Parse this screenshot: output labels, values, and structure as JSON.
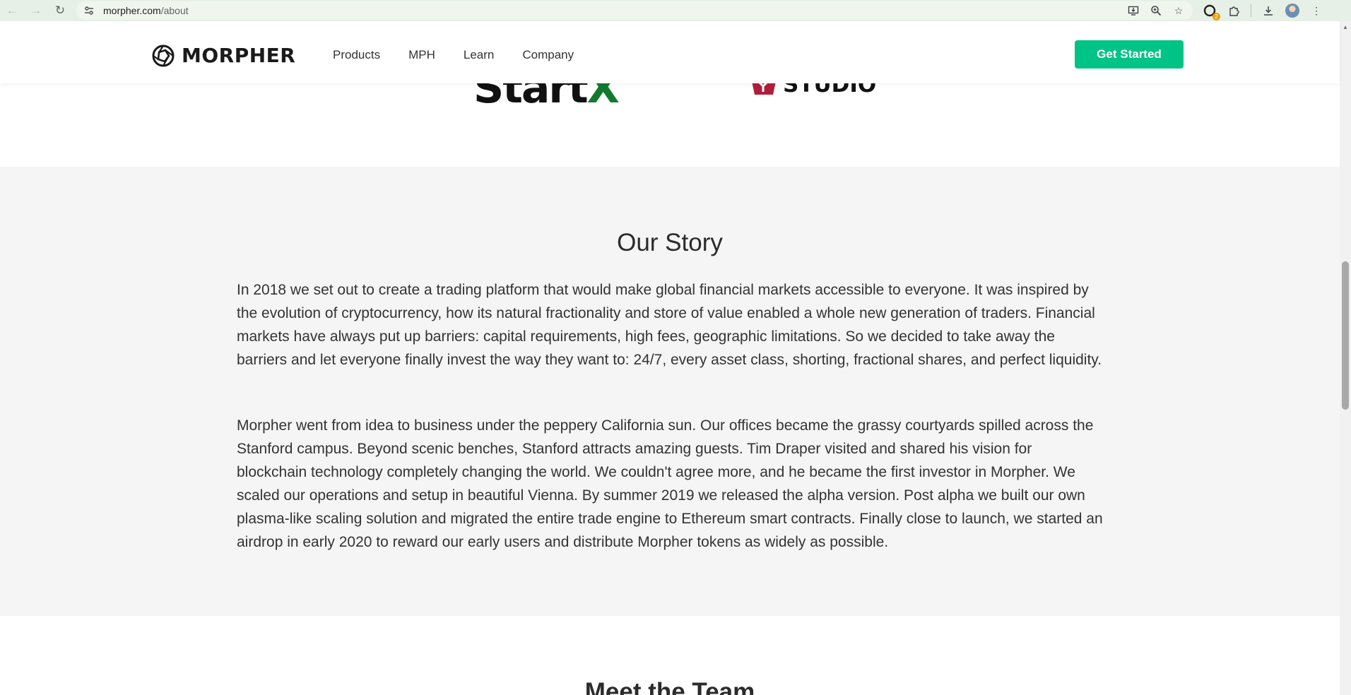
{
  "browser": {
    "url_host": "morpher.com",
    "url_path": "/about",
    "extension_badge": "2"
  },
  "header": {
    "logo_text": "MORPHER",
    "nav": [
      {
        "label": "Products"
      },
      {
        "label": "MPH"
      },
      {
        "label": "Learn"
      },
      {
        "label": "Company"
      }
    ],
    "cta_label": "Get Started"
  },
  "partners": {
    "startx_main": "Start",
    "startx_x": "X",
    "studio_word": "STUDIO"
  },
  "story": {
    "title": "Our Story",
    "paragraphs": [
      "In 2018 we set out to create a trading platform that would make global financial markets accessible to everyone. It was inspired by the evolution of cryptocurrency, how its natural fractionality and store of value enabled a whole new generation of traders. Financial markets have always put up barriers: capital requirements, high fees, geographic limitations. So we decided to take away the barriers and let everyone finally invest the way they want to: 24/7, every asset class, shorting, fractional shares, and perfect liquidity.",
      "Morpher went from idea to business under the peppery California sun. Our offices became the grassy courtyards spilled across the Stanford campus. Beyond scenic benches, Stanford attracts amazing guests. Tim Draper visited and shared his vision for blockchain technology completely changing the world. We couldn't agree more, and he became the first investor in Morpher. We scaled our operations and setup in beautiful Vienna. By summer 2019 we released the alpha version. Post alpha we built our own plasma-like scaling solution and migrated the entire trade engine to Ethereum smart contracts. Finally close to launch, we started an airdrop in early 2020 to reward our early users and distribute Morpher tokens as widely as possible."
    ]
  },
  "team": {
    "title": "Meet the Team"
  },
  "colors": {
    "accent": "#00c386",
    "story_bg": "#f5f5f5",
    "browser_bar": "#e7f0e6"
  },
  "icons": [
    "back-arrow-icon",
    "forward-arrow-icon",
    "reload-icon",
    "site-info-icon",
    "install-app-icon",
    "zoom-icon",
    "bookmark-star-icon",
    "extension-icon",
    "puzzle-icon",
    "download-icon",
    "profile-avatar",
    "kebab-menu-icon"
  ]
}
